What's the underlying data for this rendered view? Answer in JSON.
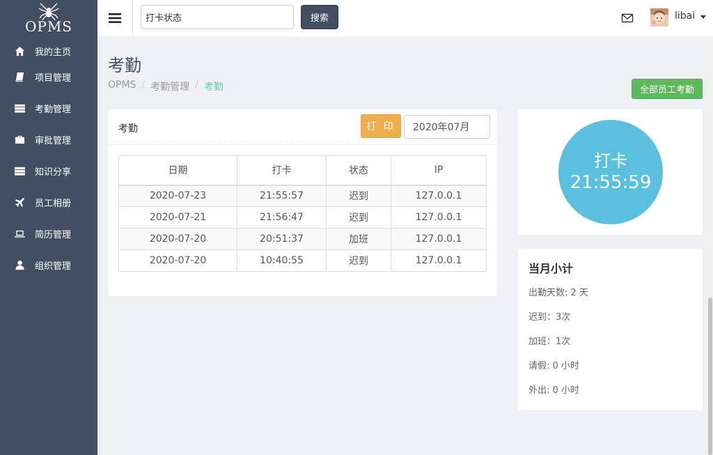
{
  "brand": {
    "logo_text": "OPMS"
  },
  "sidebar": {
    "items": [
      {
        "label": "我的主页",
        "icon": "home-icon"
      },
      {
        "label": "项目管理",
        "icon": "book-icon"
      },
      {
        "label": "考勤管理",
        "icon": "server-icon"
      },
      {
        "label": "审批管理",
        "icon": "briefcase-icon"
      },
      {
        "label": "知识分享",
        "icon": "server-icon"
      },
      {
        "label": "员工相册",
        "icon": "plane-icon"
      },
      {
        "label": "简历管理",
        "icon": "laptop-icon"
      },
      {
        "label": "组织管理",
        "icon": "user-icon"
      }
    ]
  },
  "header": {
    "search_value": "打卡状态",
    "search_button": "搜索",
    "username": "libai"
  },
  "page": {
    "title": "考勤",
    "breadcrumb": [
      "OPMS",
      "考勤管理",
      "考勤"
    ],
    "all_button": "全部员工考勤"
  },
  "attendance": {
    "panel_title": "考勤",
    "print_button": "打 印",
    "month_value": "2020年07月",
    "columns": [
      "日期",
      "打卡",
      "状态",
      "IP"
    ],
    "rows": [
      [
        "2020-07-23",
        "21:55:57",
        "迟到",
        "127.0.0.1"
      ],
      [
        "2020-07-21",
        "21:56:47",
        "迟到",
        "127.0.0.1"
      ],
      [
        "2020-07-20",
        "20:51:37",
        "加班",
        "127.0.0.1"
      ],
      [
        "2020-07-20",
        "10:40:55",
        "迟到",
        "127.0.0.1"
      ]
    ]
  },
  "clock": {
    "label": "打卡",
    "time": "21:55:59",
    "color": "#5bc0de"
  },
  "summary": {
    "title": "当月小计",
    "lines": [
      "出勤天数: 2 天",
      "迟到：3次",
      "加班：1次",
      "请假: 0 小时",
      "外出: 0 小时"
    ]
  },
  "colors": {
    "sidebar_bg": "#424f63",
    "accent_green": "#5cb85c",
    "print_orange": "#f0ad4e",
    "breadcrumb_active": "#65cea7"
  }
}
